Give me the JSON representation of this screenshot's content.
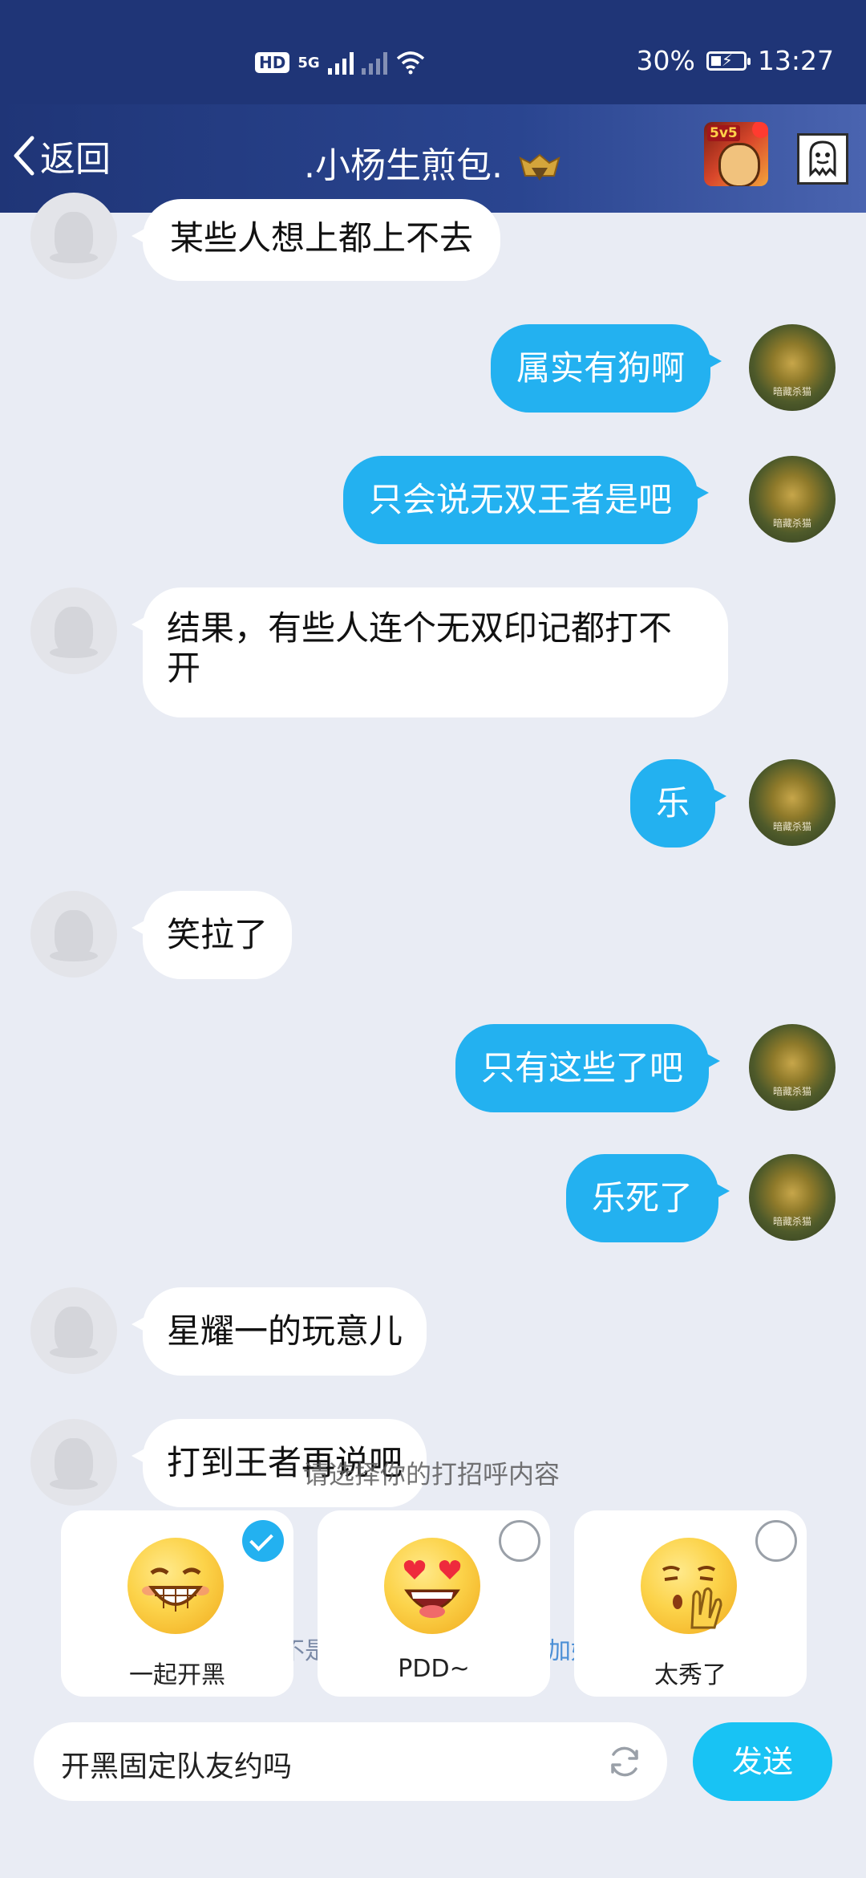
{
  "status_bar": {
    "hd": "HD",
    "network": "5G",
    "battery": "30%",
    "time": "13:27"
  },
  "header": {
    "back_label": "返回",
    "title": ".小杨生煎包.",
    "game_badge": "5v5"
  },
  "messages": [
    {
      "from": "them",
      "text": "某些人想上都上不去"
    },
    {
      "from": "me",
      "text": "属实有狗啊"
    },
    {
      "from": "me",
      "text": "只会说无双王者是吧"
    },
    {
      "from": "them",
      "text": "结果，有些人连个无双印记都打不开"
    },
    {
      "from": "me",
      "text": "乐"
    },
    {
      "from": "them",
      "text": "笑拉了"
    },
    {
      "from": "me",
      "text": "只有这些了吧"
    },
    {
      "from": "me",
      "text": "乐死了"
    },
    {
      "from": "them",
      "text": "星耀一的玩意儿"
    },
    {
      "from": "them",
      "text": "打到王者再说吧"
    }
  ],
  "my_avatar_caption": "暗藏杀猫",
  "greeting": {
    "title": "请选择你的打招呼内容",
    "options": [
      {
        "label": "一起开黑",
        "emoji": "grin-emoji",
        "selected": true
      },
      {
        "label": "PDD~",
        "emoji": "heart-eyes-emoji",
        "selected": false
      },
      {
        "label": "太秀了",
        "emoji": "clap-emoji",
        "selected": false
      }
    ],
    "peek_left": "不是",
    "peek_right": "加好"
  },
  "composer": {
    "text": "开黑固定队友约吗",
    "send_label": "发送"
  },
  "colors": {
    "header": "#1f3577",
    "out_bubble": "#23b1f0",
    "send_button": "#18c3f4",
    "background": "#e9ecf4"
  }
}
